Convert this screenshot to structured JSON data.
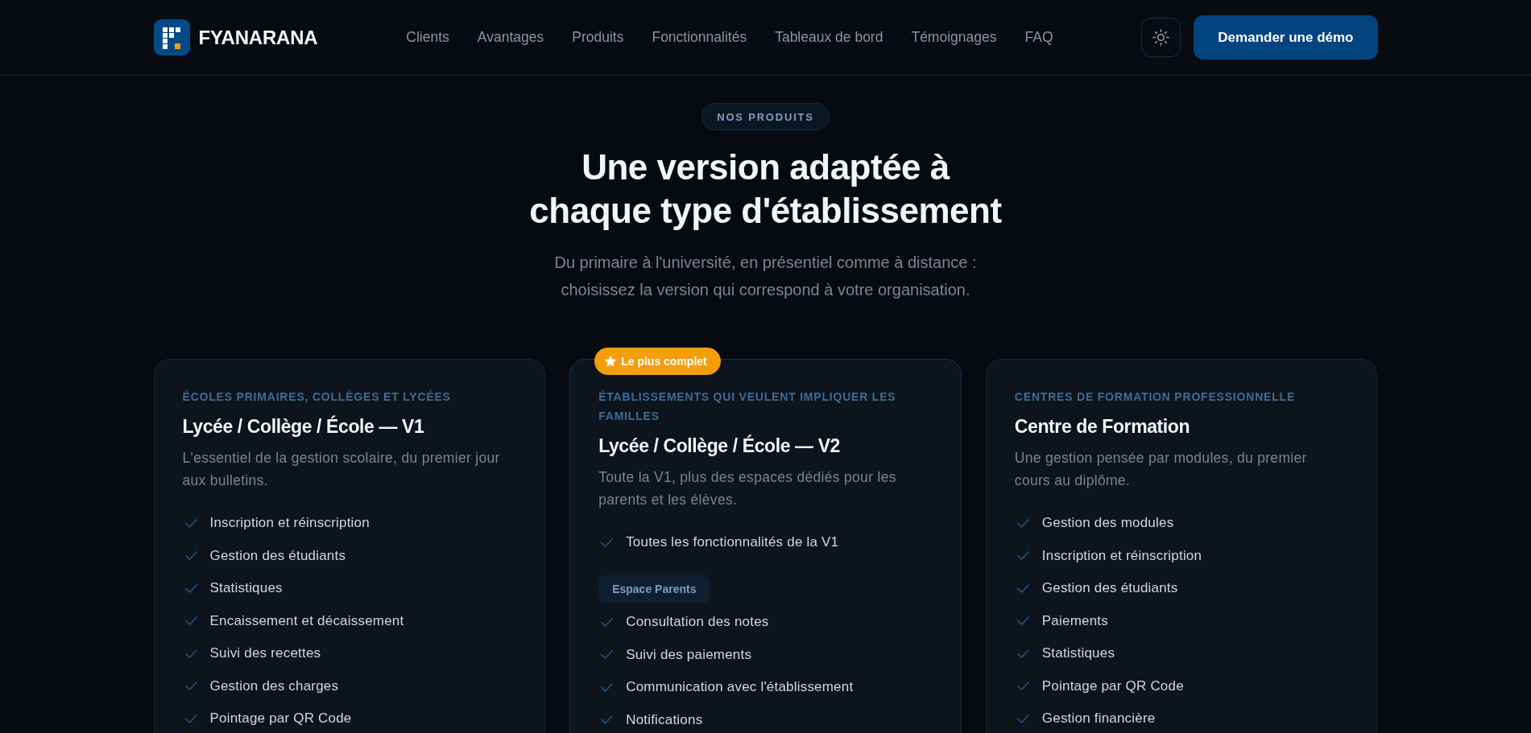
{
  "header": {
    "logo": "FYANARANA",
    "nav": [
      "Clients",
      "Avantages",
      "Produits",
      "Fonctionnalités",
      "Tableaux de bord",
      "Témoignages",
      "FAQ"
    ],
    "demo_button": "Demander une démo"
  },
  "section": {
    "eyebrow": "NOS PRODUITS",
    "title": "Une version adaptée à chaque type d'établissement",
    "subtitle": "Du primaire à l'université, en présentiel comme à distance : choisissez la version qui correspond à votre organisation."
  },
  "cards": [
    {
      "featured": false,
      "eyebrow": "ÉCOLES PRIMAIRES, COLLÈGES ET LYCÉES",
      "title": "Lycée / Collège / École — V1",
      "description": "L'essentiel de la gestion scolaire, du premier jour aux bulletins.",
      "groups": [
        {
          "items": [
            "Inscription et réinscription",
            "Gestion des étudiants",
            "Statistiques",
            "Encaissement et décaissement",
            "Suivi des recettes",
            "Gestion des charges",
            "Pointage par QR Code"
          ]
        }
      ]
    },
    {
      "featured": true,
      "badge": "Le plus complet",
      "eyebrow": "ÉTABLISSEMENTS QUI VEULENT IMPLIQUER LES FAMILLES",
      "title": "Lycée / Collège / École — V2",
      "description": "Toute la V1, plus des espaces dédiés pour les parents et les élèves.",
      "groups": [
        {
          "items": [
            "Toutes les fonctionnalités de la V1"
          ]
        },
        {
          "label": "Espace Parents",
          "items": [
            "Consultation des notes",
            "Suivi des paiements",
            "Communication avec l'établissement",
            "Notifications"
          ]
        }
      ]
    },
    {
      "featured": false,
      "eyebrow": "CENTRES DE FORMATION PROFESSIONNELLE",
      "title": "Centre de Formation",
      "description": "Une gestion pensée par modules, du premier cours au diplôme.",
      "groups": [
        {
          "items": [
            "Gestion des modules",
            "Inscription et réinscription",
            "Gestion des étudiants",
            "Paiements",
            "Statistiques",
            "Pointage par QR Code",
            "Gestion financière"
          ]
        }
      ]
    }
  ]
}
